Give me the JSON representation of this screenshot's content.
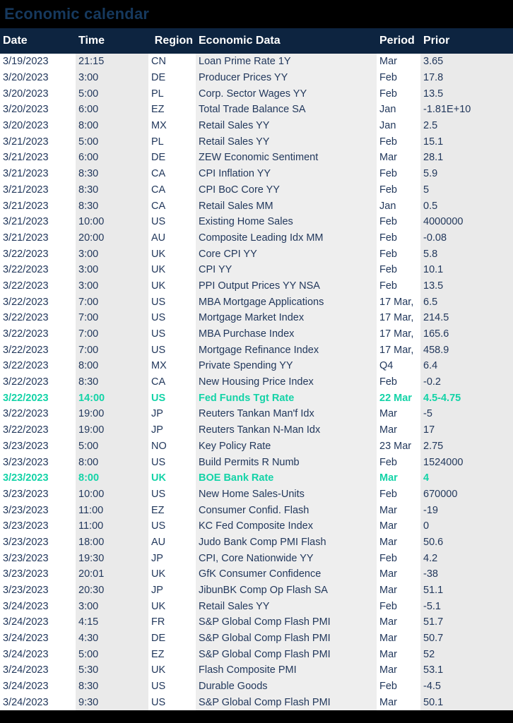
{
  "page": {
    "title": "Economic calendar",
    "background_color": "#000000",
    "title_color": "#16395e",
    "header_bg_color": "#0d2440",
    "header_text_color": "#ffffff",
    "body_text_color": "#22385c",
    "highlight_color": "#13d3a7",
    "column_shade_light": "#ffffff",
    "column_shade_gray": "#eaeaea"
  },
  "table": {
    "columns": [
      {
        "key": "date",
        "label": "Date"
      },
      {
        "key": "time",
        "label": "Time"
      },
      {
        "key": "region",
        "label": "Region"
      },
      {
        "key": "data",
        "label": "Economic Data"
      },
      {
        "key": "period",
        "label": "Period"
      },
      {
        "key": "prior",
        "label": "Prior"
      }
    ],
    "rows": [
      {
        "date": "3/19/2023",
        "time": "21:15",
        "region": "CN",
        "data": "Loan Prime Rate 1Y",
        "period": "Mar",
        "prior": "3.65",
        "highlight": false
      },
      {
        "date": "3/20/2023",
        "time": "3:00",
        "region": "DE",
        "data": "Producer Prices YY",
        "period": "Feb",
        "prior": "17.8",
        "highlight": false
      },
      {
        "date": "3/20/2023",
        "time": "5:00",
        "region": "PL",
        "data": "Corp. Sector Wages YY",
        "period": "Feb",
        "prior": "13.5",
        "highlight": false
      },
      {
        "date": "3/20/2023",
        "time": "6:00",
        "region": "EZ",
        "data": "Total Trade Balance SA",
        "period": "Jan",
        "prior": "-1.81E+10",
        "highlight": false
      },
      {
        "date": "3/20/2023",
        "time": "8:00",
        "region": "MX",
        "data": "Retail Sales YY",
        "period": "Jan",
        "prior": "2.5",
        "highlight": false
      },
      {
        "date": "3/21/2023",
        "time": "5:00",
        "region": "PL",
        "data": "Retail Sales YY",
        "period": "Feb",
        "prior": "15.1",
        "highlight": false
      },
      {
        "date": "3/21/2023",
        "time": "6:00",
        "region": "DE",
        "data": "ZEW Economic Sentiment",
        "period": "Mar",
        "prior": "28.1",
        "highlight": false
      },
      {
        "date": "3/21/2023",
        "time": "8:30",
        "region": "CA",
        "data": "CPI Inflation YY",
        "period": "Feb",
        "prior": "5.9",
        "highlight": false
      },
      {
        "date": "3/21/2023",
        "time": "8:30",
        "region": "CA",
        "data": "CPI BoC Core YY",
        "period": "Feb",
        "prior": "5",
        "highlight": false
      },
      {
        "date": "3/21/2023",
        "time": "8:30",
        "region": "CA",
        "data": "Retail Sales MM",
        "period": "Jan",
        "prior": "0.5",
        "highlight": false
      },
      {
        "date": "3/21/2023",
        "time": "10:00",
        "region": "US",
        "data": "Existing Home Sales",
        "period": "Feb",
        "prior": "4000000",
        "highlight": false
      },
      {
        "date": "3/21/2023",
        "time": "20:00",
        "region": "AU",
        "data": "Composite Leading Idx MM",
        "period": "Feb",
        "prior": "-0.08",
        "highlight": false
      },
      {
        "date": "3/22/2023",
        "time": "3:00",
        "region": "UK",
        "data": "Core CPI YY",
        "period": "Feb",
        "prior": "5.8",
        "highlight": false
      },
      {
        "date": "3/22/2023",
        "time": "3:00",
        "region": "UK",
        "data": "CPI YY",
        "period": "Feb",
        "prior": "10.1",
        "highlight": false
      },
      {
        "date": "3/22/2023",
        "time": "3:00",
        "region": "UK",
        "data": "PPI Output Prices YY NSA",
        "period": "Feb",
        "prior": "13.5",
        "highlight": false
      },
      {
        "date": "3/22/2023",
        "time": "7:00",
        "region": "US",
        "data": "MBA Mortgage Applications",
        "period": "17 Mar, ",
        "prior": "6.5",
        "highlight": false
      },
      {
        "date": "3/22/2023",
        "time": "7:00",
        "region": "US",
        "data": "Mortgage Market Index",
        "period": "17 Mar, ",
        "prior": "214.5",
        "highlight": false
      },
      {
        "date": "3/22/2023",
        "time": "7:00",
        "region": "US",
        "data": "MBA Purchase Index",
        "period": "17 Mar, ",
        "prior": "165.6",
        "highlight": false
      },
      {
        "date": "3/22/2023",
        "time": "7:00",
        "region": "US",
        "data": "Mortgage Refinance Index",
        "period": "17 Mar, ",
        "prior": "458.9",
        "highlight": false
      },
      {
        "date": "3/22/2023",
        "time": "8:00",
        "region": "MX",
        "data": "Private Spending YY",
        "period": "Q4",
        "prior": "6.4",
        "highlight": false
      },
      {
        "date": "3/22/2023",
        "time": "8:30",
        "region": "CA",
        "data": "New Housing Price Index",
        "period": "Feb",
        "prior": "-0.2",
        "highlight": false
      },
      {
        "date": "3/22/2023",
        "time": "14:00",
        "region": "US",
        "data": "Fed Funds Tgt Rate",
        "period": "22 Mar",
        "prior": "4.5-4.75",
        "highlight": true
      },
      {
        "date": "3/22/2023",
        "time": "19:00",
        "region": "JP",
        "data": "Reuters Tankan Man'f Idx",
        "period": "Mar",
        "prior": "-5",
        "highlight": false
      },
      {
        "date": "3/22/2023",
        "time": "19:00",
        "region": "JP",
        "data": "Reuters Tankan N-Man Idx",
        "period": "Mar",
        "prior": "17",
        "highlight": false
      },
      {
        "date": "3/23/2023",
        "time": "5:00",
        "region": "NO",
        "data": "Key Policy Rate",
        "period": "23 Mar",
        "prior": "2.75",
        "highlight": false
      },
      {
        "date": "3/23/2023",
        "time": "8:00",
        "region": "US",
        "data": "Build Permits R Numb",
        "period": "Feb",
        "prior": "1524000",
        "highlight": false
      },
      {
        "date": "3/23/2023",
        "time": "8:00",
        "region": "UK",
        "data": "BOE Bank Rate",
        "period": "Mar",
        "prior": "4",
        "highlight": true
      },
      {
        "date": "3/23/2023",
        "time": "10:00",
        "region": "US",
        "data": "New Home Sales-Units",
        "period": "Feb",
        "prior": "670000",
        "highlight": false
      },
      {
        "date": "3/23/2023",
        "time": "11:00",
        "region": "EZ",
        "data": "Consumer Confid. Flash",
        "period": "Mar",
        "prior": "-19",
        "highlight": false
      },
      {
        "date": "3/23/2023",
        "time": "11:00",
        "region": "US",
        "data": "KC Fed Composite Index",
        "period": "Mar",
        "prior": "0",
        "highlight": false
      },
      {
        "date": "3/23/2023",
        "time": "18:00",
        "region": "AU",
        "data": "Judo Bank Comp PMI Flash",
        "period": "Mar",
        "prior": "50.6",
        "highlight": false
      },
      {
        "date": "3/23/2023",
        "time": "19:30",
        "region": "JP",
        "data": "CPI, Core Nationwide YY",
        "period": "Feb",
        "prior": "4.2",
        "highlight": false
      },
      {
        "date": "3/23/2023",
        "time": "20:01",
        "region": "UK",
        "data": "GfK Consumer Confidence",
        "period": "Mar",
        "prior": "-38",
        "highlight": false
      },
      {
        "date": "3/23/2023",
        "time": "20:30",
        "region": "JP",
        "data": "JibunBK Comp Op Flash SA",
        "period": "Mar",
        "prior": "51.1",
        "highlight": false
      },
      {
        "date": "3/24/2023",
        "time": "3:00",
        "region": "UK",
        "data": "Retail Sales YY",
        "period": "Feb",
        "prior": "-5.1",
        "highlight": false
      },
      {
        "date": "3/24/2023",
        "time": "4:15",
        "region": "FR",
        "data": "S&P Global Comp Flash PMI",
        "period": "Mar",
        "prior": "51.7",
        "highlight": false
      },
      {
        "date": "3/24/2023",
        "time": "4:30",
        "region": "DE",
        "data": "S&P Global Comp Flash PMI",
        "period": "Mar",
        "prior": "50.7",
        "highlight": false
      },
      {
        "date": "3/24/2023",
        "time": "5:00",
        "region": "EZ",
        "data": "S&P Global Comp Flash PMI",
        "period": "Mar",
        "prior": "52",
        "highlight": false
      },
      {
        "date": "3/24/2023",
        "time": "5:30",
        "region": "UK",
        "data": "Flash Composite PMI",
        "period": "Mar",
        "prior": "53.1",
        "highlight": false
      },
      {
        "date": "3/24/2023",
        "time": "8:30",
        "region": "US",
        "data": "Durable Goods",
        "period": "Feb",
        "prior": "-4.5",
        "highlight": false
      },
      {
        "date": "3/24/2023",
        "time": "9:30",
        "region": "US",
        "data": "S&P Global Comp Flash PMI",
        "period": "Mar",
        "prior": "50.1",
        "highlight": false
      }
    ]
  }
}
